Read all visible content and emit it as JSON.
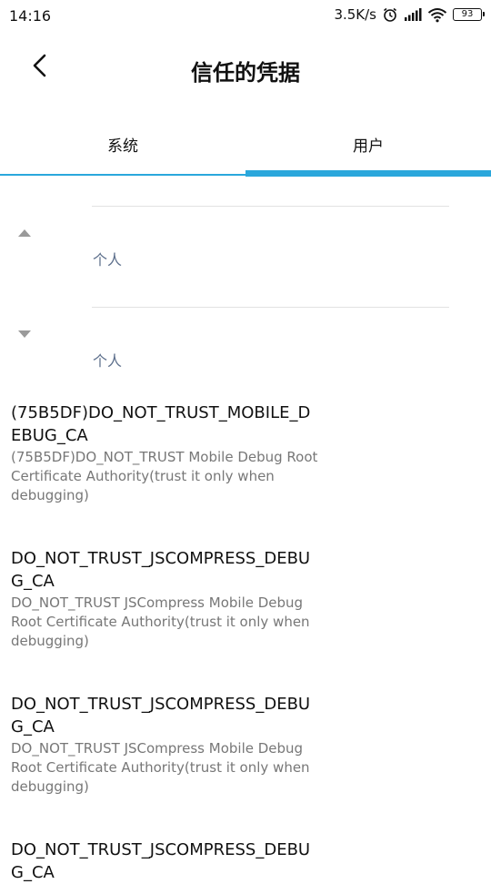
{
  "status_bar": {
    "time": "14:16",
    "network_speed": "3.5K/s",
    "battery_level": "93",
    "icons": [
      "alarm-icon",
      "signal-icon",
      "wifi-icon",
      "battery-icon"
    ]
  },
  "header": {
    "title": "信任的凭据",
    "back_icon": "chevron-left-icon"
  },
  "tabs": [
    {
      "label": "系统",
      "selected": false
    },
    {
      "label": "用户",
      "selected": true
    }
  ],
  "colors": {
    "accent": "#2aa7dc",
    "group_label": "#5d6f8c",
    "secondary_text": "#777777"
  },
  "groups": [
    {
      "label": "个人",
      "state": "expanded",
      "arrow_icon": "triangle-up-icon"
    },
    {
      "label": "个人",
      "state": "expanded",
      "arrow_icon": "triangle-down-icon"
    }
  ],
  "certificates": [
    {
      "title": "(75B5DF)DO_NOT_TRUST_MOBILE_DEBUG_CA",
      "description": "(75B5DF)DO_NOT_TRUST Mobile Debug Root Certificate Authority(trust it only when debugging)"
    },
    {
      "title": "DO_NOT_TRUST_JSCOMPRESS_DEBUG_CA",
      "description": "DO_NOT_TRUST JSCompress Mobile Debug Root Certificate Authority(trust it only when debugging)"
    },
    {
      "title": "DO_NOT_TRUST_JSCOMPRESS_DEBUG_CA",
      "description": "DO_NOT_TRUST JSCompress Mobile Debug Root Certificate Authority(trust it only when debugging)"
    },
    {
      "title": "DO_NOT_TRUST_JSCOMPRESS_DEBUG_CA",
      "description": ""
    }
  ]
}
